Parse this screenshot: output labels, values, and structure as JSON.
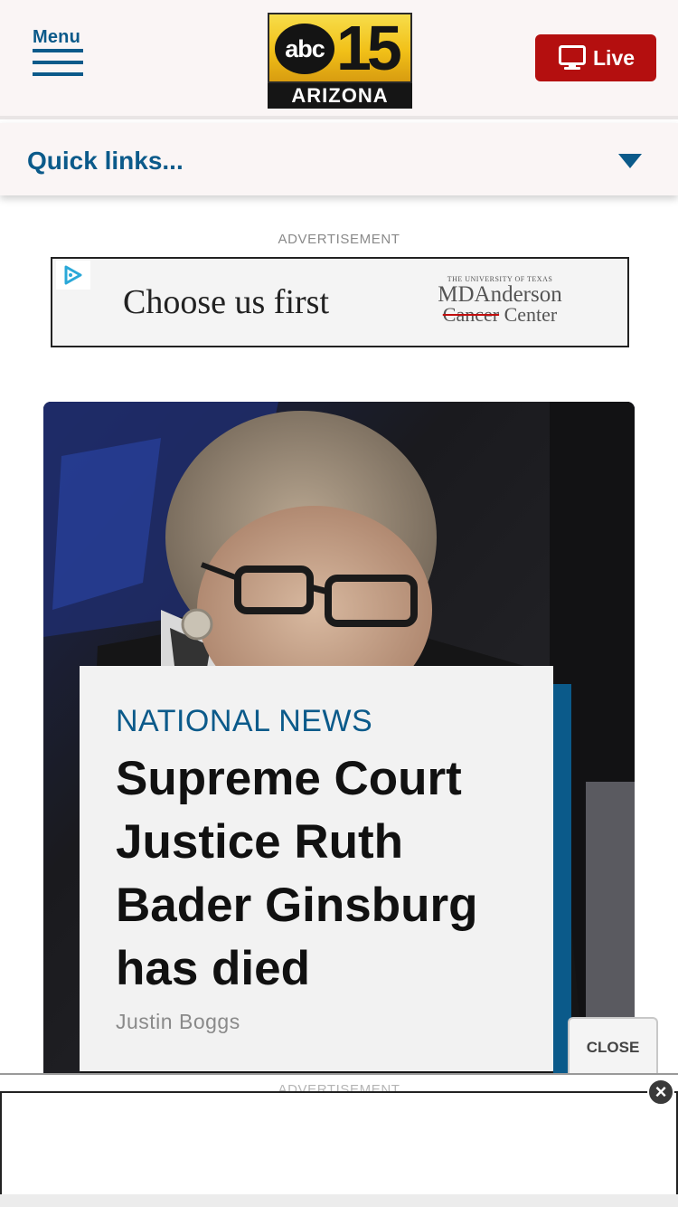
{
  "header": {
    "menu_label": "Menu",
    "logo": {
      "abc": "abc",
      "number": "15",
      "region": "ARIZONA"
    },
    "live_label": "Live"
  },
  "quick_links": {
    "label": "Quick links..."
  },
  "advertisement": {
    "label": "ADVERTISEMENT",
    "headline": "Choose us first",
    "brand_small": "THE UNIVERSITY OF TEXAS",
    "brand_name": "MDAnderson",
    "brand_sub_cancer": "Cancer",
    "brand_sub_center": "Center"
  },
  "story": {
    "category": "NATIONAL NEWS",
    "title": "Supreme Court Justice Ruth Bader Ginsburg has died",
    "author": "Justin Boggs"
  },
  "sticky_ad": {
    "close_label": "CLOSE",
    "label": "ADVERTISEMENT",
    "dismiss_symbol": "×"
  },
  "colors": {
    "brand_blue": "#0b5a8a",
    "live_red": "#b40f0f",
    "header_bg": "#faf5f5"
  },
  "icons": [
    "hamburger-icon",
    "tv-icon",
    "caret-down-icon",
    "adchoices-icon",
    "close-x-icon"
  ]
}
